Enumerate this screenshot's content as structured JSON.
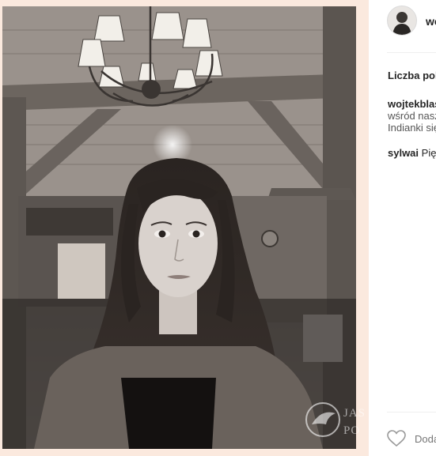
{
  "post": {
    "username": "wojtekblaszczyk",
    "likes_label": "Liczba polubień",
    "caption_user": "wojtekblaszczyk",
    "caption_line1": "wśród naszych",
    "caption_line2": "Indianki się",
    "comment_user": "sylwai",
    "comment_text": "Piękna"
  },
  "actions": {
    "add_comment_placeholder": "Dodaj komentarz..."
  },
  "watermark": {
    "line1": "JAS",
    "line2": "PO"
  },
  "colors": {
    "frame_bg": "#fbe9de",
    "panel_bg": "#ffffff",
    "text": "#262626"
  }
}
